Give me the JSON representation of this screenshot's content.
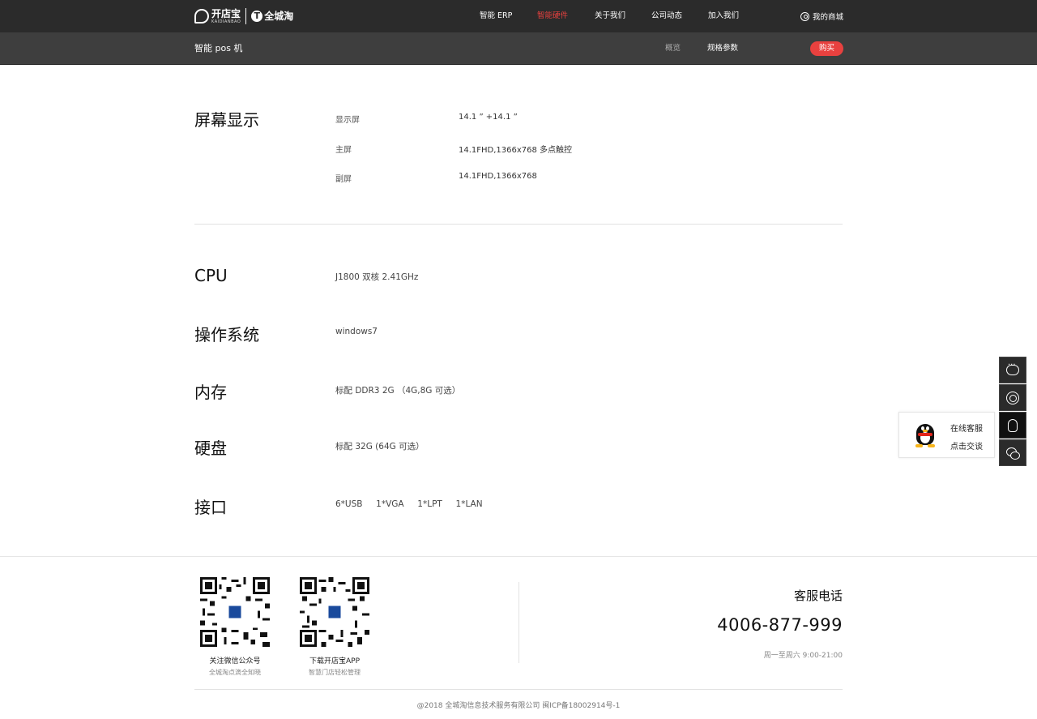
{
  "header": {
    "logo_primary": "开店宝",
    "logo_primary_en": "KAIDIANBAO",
    "logo_secondary": "全城淘",
    "logo_secondary_mark": "T",
    "nav": [
      {
        "label": "智能 ERP",
        "active": false
      },
      {
        "label": "智能硬件",
        "active": true
      },
      {
        "label": "关于我们",
        "active": false
      },
      {
        "label": "公司动态",
        "active": false
      },
      {
        "label": "加入我们",
        "active": false
      }
    ],
    "mall_label": "我的商城"
  },
  "subnav": {
    "product_name": "智能 pos 机",
    "links": [
      {
        "label": "概览",
        "active": false
      },
      {
        "label": "规格参数",
        "active": true
      }
    ],
    "buy_label": "购买"
  },
  "specs": {
    "screen": {
      "title": "屏幕显示",
      "rows": [
        {
          "label": "显示屏",
          "value": "14.1 ”  +14.1 ”"
        },
        {
          "label": "主屏",
          "value": "14.1FHD,1366x768   多点触控"
        },
        {
          "label": "副屏",
          "value": "14.1FHD,1366x768"
        }
      ]
    },
    "cpu": {
      "title": "CPU",
      "value": "J1800 双核 2.41GHz"
    },
    "os": {
      "title": "操作系统",
      "value": "windows7"
    },
    "memory": {
      "title": "内存",
      "value": "标配 DDR3   2G （4G,8G 可选）"
    },
    "disk": {
      "title": "硬盘",
      "value": "标配 32G (64G 可选）"
    },
    "ports": {
      "title": "接口",
      "value": "6*USB     1*VGA     1*LPT     1*LAN"
    }
  },
  "sidebar": {
    "qq_popup": {
      "line1": "在线客服",
      "line2": "点击交谈"
    }
  },
  "footer": {
    "qr_codes": [
      {
        "caption": "关注微信公众号",
        "sub": "全城淘点滴全知晓"
      },
      {
        "caption": "下载开店宝APP",
        "sub": "智慧门店轻松管理"
      }
    ],
    "hotline_title": "客服电话",
    "hotline_number": "4006-877-999",
    "hotline_hours": "周一至周六 9:00-21:00",
    "copyright": "@2018 全城淘信息技术服务有限公司 闽ICP备18002914号-1"
  },
  "colors": {
    "accent": "#e8413f",
    "topbar": "#2b2b2b",
    "subbar": "#3e3e3e"
  }
}
